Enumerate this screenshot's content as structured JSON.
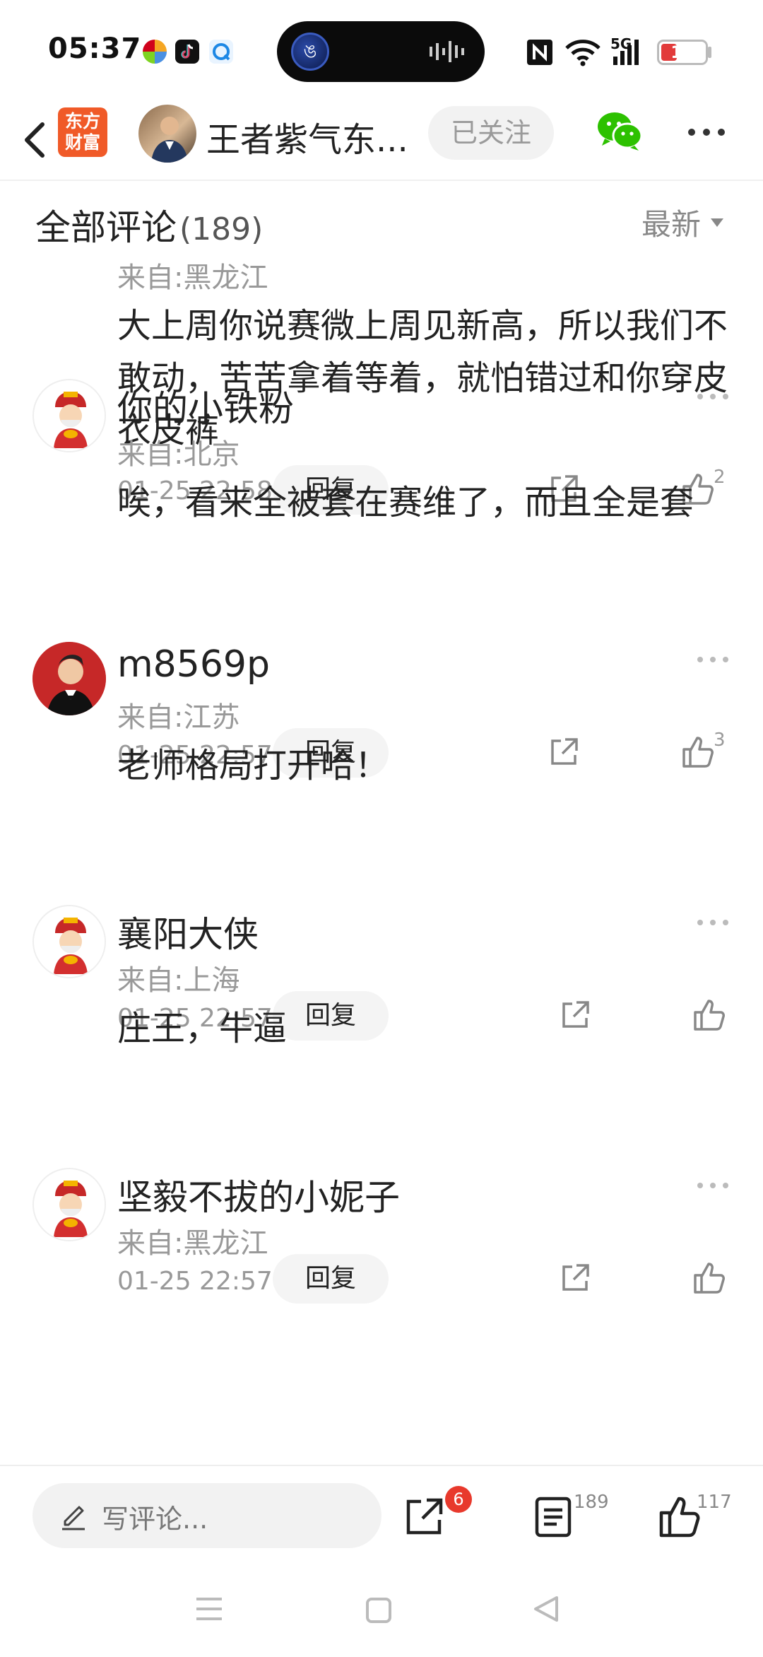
{
  "status_bar": {
    "time": "05:37",
    "network": "5G",
    "battery": "15",
    "icons": [
      "colorful-app-icon",
      "tiktok-icon",
      "browser-icon",
      "nfc-icon",
      "wifi-icon",
      "signal-icon",
      "battery-icon"
    ]
  },
  "header": {
    "back_icon": "chevron-left-icon",
    "app_logo_line1": "东方",
    "app_logo_line2": "财富",
    "author_name": "王者紫气东...",
    "follow_label": "已关注",
    "share_icon": "wechat-icon",
    "more_icon": "more-dots-icon"
  },
  "comments": {
    "title": "全部评论",
    "count": "(189)",
    "sort_label": "最新",
    "items": [
      {
        "name": "",
        "location": "来自:黑龙江",
        "text": "大上周你说赛微上周见新高，所以我们不敢动，苦苦拿着等着，就怕错过和你穿皮衣皮裤",
        "time": "01-25 22:58",
        "reply": "回复",
        "likes": "2"
      },
      {
        "name": "你的小铁粉",
        "location": "来自:北京",
        "text": "唉，看来全被套在赛维了，而且全是套",
        "time": "01-25 22:57",
        "reply": "回复",
        "likes": "3"
      },
      {
        "name": "m8569p",
        "location": "来自:江苏",
        "text": "老师格局打开哈！",
        "time": "01-25 22:57",
        "reply": "回复",
        "likes": ""
      },
      {
        "name": "襄阳大侠",
        "location": "来自:上海",
        "text": "庄王，牛逼",
        "time": "01-25 22:57",
        "reply": "回复",
        "likes": ""
      },
      {
        "name": "坚毅不拔的小妮子",
        "location": "来自:黑龙江",
        "text": "",
        "time": "",
        "reply": "",
        "likes": ""
      }
    ]
  },
  "bottom_bar": {
    "write_placeholder": "写评论...",
    "share_badge": "6",
    "comment_count": "189",
    "like_count": "117"
  },
  "colors": {
    "brand_orange": "#f05a28",
    "badge_red": "#e8392c",
    "wechat_green": "#2dc100"
  }
}
